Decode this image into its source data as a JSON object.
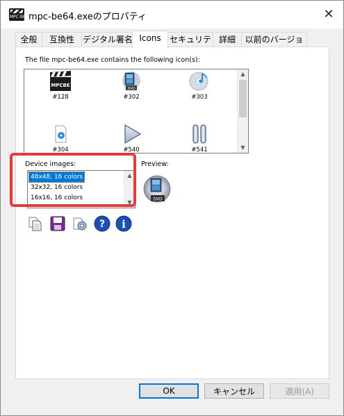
{
  "window": {
    "title": "mpc-be64.exeのプロパティ",
    "close_glyph": "✕",
    "app_icon_text": "MPC·BE"
  },
  "tabs": [
    {
      "label": "全般"
    },
    {
      "label": "互換性"
    },
    {
      "label": "デジタル署名"
    },
    {
      "label": "Icons",
      "active": true
    },
    {
      "label": "セキュリティ"
    },
    {
      "label": "詳細"
    },
    {
      "label": "以前のバージョン"
    }
  ],
  "icons_panel": {
    "header": "The file mpc-be64.exe contains the following icon(s):",
    "icons": [
      {
        "label": "#128",
        "icon": "mpcbe-clapper-icon",
        "img_text": "MPCBE"
      },
      {
        "label": "#302",
        "icon": "dvd-film-icon",
        "img_text": "DVD"
      },
      {
        "label": "#303",
        "icon": "audio-cd-icon"
      },
      {
        "label": "#304",
        "icon": "audio-file-icon"
      },
      {
        "label": "#540",
        "icon": "play-icon"
      },
      {
        "label": "#541",
        "icon": "pause-icon"
      }
    ],
    "scroll": {
      "up": "▲",
      "down": "▼"
    }
  },
  "device_images": {
    "label": "Device images:",
    "items": [
      {
        "text": "48x48, 16 colors",
        "selected": true
      },
      {
        "text": "32x32, 16 colors",
        "selected": false
      },
      {
        "text": "16x16, 16 colors",
        "selected": false
      }
    ]
  },
  "preview": {
    "label": "Preview:",
    "icon": "dvd-disc-preview-icon",
    "img_text": "DVD"
  },
  "toolbar": [
    {
      "icon": "copy-icon"
    },
    {
      "icon": "save-icon"
    },
    {
      "icon": "settings-icon"
    },
    {
      "icon": "help-icon",
      "glyph": "?"
    },
    {
      "icon": "info-icon",
      "glyph": "i"
    }
  ],
  "buttons": {
    "ok": "OK",
    "cancel": "キャンセル",
    "apply": "適用(A)"
  },
  "colors": {
    "accent": "#0078d7",
    "highlight": "#e53a3a",
    "help_blue": "#1d4fb8",
    "save_purple": "#7a2d8c"
  }
}
